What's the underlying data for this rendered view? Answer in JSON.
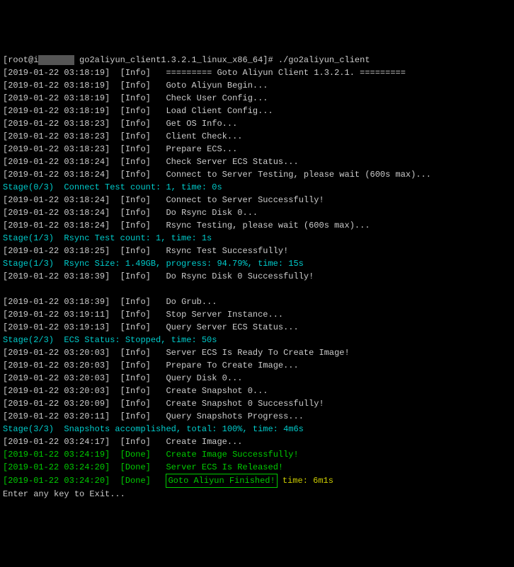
{
  "prompt": {
    "user": "[root@i",
    "dir_masked": "       ",
    "dir": " go2aliyun_client1.3.2.1_linux_x86_64]#",
    "command": " ./go2aliyun_client"
  },
  "lines": [
    {
      "ts": "[2019-01-22 03:18:19]",
      "level": "[Info]",
      "msg": "========= Goto Aliyun Client 1.3.2.1. =========",
      "tsColor": "white",
      "levelColor": "white",
      "msgColor": "white"
    },
    {
      "ts": "[2019-01-22 03:18:19]",
      "level": "[Info]",
      "msg": "Goto Aliyun Begin...",
      "tsColor": "white",
      "levelColor": "white",
      "msgColor": "white"
    },
    {
      "ts": "[2019-01-22 03:18:19]",
      "level": "[Info]",
      "msg": "Check User Config...",
      "tsColor": "white",
      "levelColor": "white",
      "msgColor": "white"
    },
    {
      "ts": "[2019-01-22 03:18:19]",
      "level": "[Info]",
      "msg": "Load Client Config...",
      "tsColor": "white",
      "levelColor": "white",
      "msgColor": "white"
    },
    {
      "ts": "[2019-01-22 03:18:23]",
      "level": "[Info]",
      "msg": "Get OS Info...",
      "tsColor": "white",
      "levelColor": "white",
      "msgColor": "white"
    },
    {
      "ts": "[2019-01-22 03:18:23]",
      "level": "[Info]",
      "msg": "Client Check...",
      "tsColor": "white",
      "levelColor": "white",
      "msgColor": "white"
    },
    {
      "ts": "[2019-01-22 03:18:23]",
      "level": "[Info]",
      "msg": "Prepare ECS...",
      "tsColor": "white",
      "levelColor": "white",
      "msgColor": "white"
    },
    {
      "ts": "[2019-01-22 03:18:24]",
      "level": "[Info]",
      "msg": "Check Server ECS Status...",
      "tsColor": "white",
      "levelColor": "white",
      "msgColor": "white"
    },
    {
      "ts": "[2019-01-22 03:18:24]",
      "level": "[Info]",
      "msg": "Connect to Server Testing, please wait (600s max)...",
      "tsColor": "white",
      "levelColor": "white",
      "msgColor": "white"
    },
    {
      "stage": "Stage(0/3)",
      "stageMsg": "Connect Test count: 1, time: 0s"
    },
    {
      "ts": "[2019-01-22 03:18:24]",
      "level": "[Info]",
      "msg": "Connect to Server Successfully!",
      "tsColor": "white",
      "levelColor": "white",
      "msgColor": "white"
    },
    {
      "ts": "[2019-01-22 03:18:24]",
      "level": "[Info]",
      "msg": "Do Rsync Disk 0...",
      "tsColor": "white",
      "levelColor": "white",
      "msgColor": "white"
    },
    {
      "ts": "[2019-01-22 03:18:24]",
      "level": "[Info]",
      "msg": "Rsync Testing, please wait (600s max)...",
      "tsColor": "white",
      "levelColor": "white",
      "msgColor": "white"
    },
    {
      "stage": "Stage(1/3)",
      "stageMsg": "Rsync Test count: 1, time: 1s"
    },
    {
      "ts": "[2019-01-22 03:18:25]",
      "level": "[Info]",
      "msg": "Rsync Test Successfully!",
      "tsColor": "white",
      "levelColor": "white",
      "msgColor": "white"
    },
    {
      "stage": "Stage(1/3)",
      "stageMsg": "Rsync Size: 1.49GB, progress: 94.79%, time: 15s"
    },
    {
      "ts": "[2019-01-22 03:18:39]",
      "level": "[Info]",
      "msg": "Do Rsync Disk 0 Successfully!",
      "tsColor": "white",
      "levelColor": "white",
      "msgColor": "white"
    },
    {
      "blank": true
    },
    {
      "ts": "[2019-01-22 03:18:39]",
      "level": "[Info]",
      "msg": "Do Grub...",
      "tsColor": "white",
      "levelColor": "white",
      "msgColor": "white"
    },
    {
      "ts": "[2019-01-22 03:19:11]",
      "level": "[Info]",
      "msg": "Stop Server Instance...",
      "tsColor": "white",
      "levelColor": "white",
      "msgColor": "white"
    },
    {
      "ts": "[2019-01-22 03:19:13]",
      "level": "[Info]",
      "msg": "Query Server ECS Status...",
      "tsColor": "white",
      "levelColor": "white",
      "msgColor": "white"
    },
    {
      "stage": "Stage(2/3)",
      "stageMsg": "ECS Status: Stopped, time: 50s"
    },
    {
      "ts": "[2019-01-22 03:20:03]",
      "level": "[Info]",
      "msg": "Server ECS Is Ready To Create Image!",
      "tsColor": "white",
      "levelColor": "white",
      "msgColor": "white"
    },
    {
      "ts": "[2019-01-22 03:20:03]",
      "level": "[Info]",
      "msg": "Prepare To Create Image...",
      "tsColor": "white",
      "levelColor": "white",
      "msgColor": "white"
    },
    {
      "ts": "[2019-01-22 03:20:03]",
      "level": "[Info]",
      "msg": "Query Disk 0...",
      "tsColor": "white",
      "levelColor": "white",
      "msgColor": "white"
    },
    {
      "ts": "[2019-01-22 03:20:03]",
      "level": "[Info]",
      "msg": "Create Snapshot 0...",
      "tsColor": "white",
      "levelColor": "white",
      "msgColor": "white"
    },
    {
      "ts": "[2019-01-22 03:20:09]",
      "level": "[Info]",
      "msg": "Create Snapshot 0 Successfully!",
      "tsColor": "white",
      "levelColor": "white",
      "msgColor": "white"
    },
    {
      "ts": "[2019-01-22 03:20:11]",
      "level": "[Info]",
      "msg": "Query Snapshots Progress...",
      "tsColor": "white",
      "levelColor": "white",
      "msgColor": "white"
    },
    {
      "stage": "Stage(3/3)",
      "stageMsg": "Snapshots accomplished, total: 100%, time: 4m6s"
    },
    {
      "ts": "[2019-01-22 03:24:17]",
      "level": "[Info]",
      "msg": "Create Image...",
      "tsColor": "white",
      "levelColor": "white",
      "msgColor": "white"
    },
    {
      "ts": "[2019-01-22 03:24:19]",
      "level": "[Done]",
      "msg": "Create Image Successfully!",
      "tsColor": "green",
      "levelColor": "green",
      "msgColor": "green"
    },
    {
      "ts": "[2019-01-22 03:24:20]",
      "level": "[Done]",
      "msg": "Server ECS Is Released!",
      "tsColor": "green",
      "levelColor": "green",
      "msgColor": "green"
    },
    {
      "ts": "[2019-01-22 03:24:20]",
      "level": "[Done]",
      "msg": "Goto Aliyun Finished!",
      "tsColor": "green",
      "levelColor": "green",
      "msgColor": "green",
      "boxed": true,
      "suffix": " time: 6m1s",
      "suffixColor": "yellow"
    }
  ],
  "exitPrompt": "Enter any key to Exit..."
}
